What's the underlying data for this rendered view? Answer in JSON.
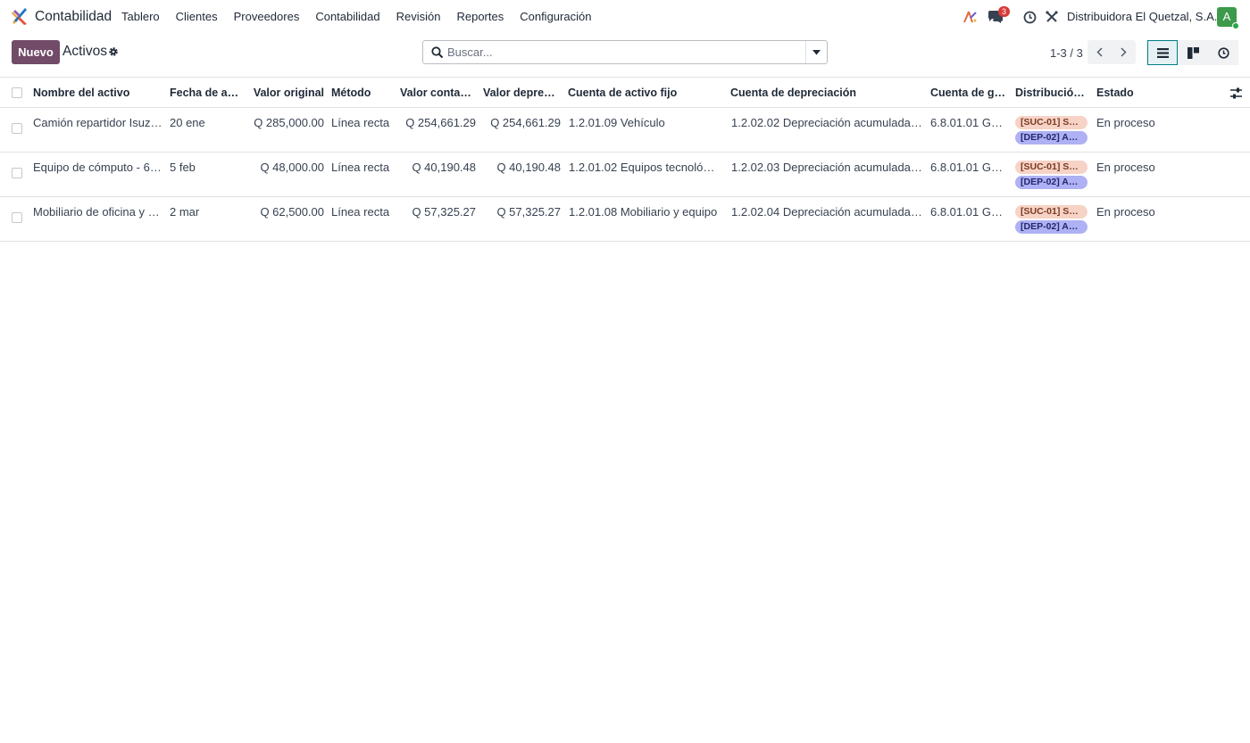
{
  "app": {
    "name": "Contabilidad",
    "menu": [
      "Tablero",
      "Clientes",
      "Proveedores",
      "Contabilidad",
      "Revisión",
      "Reportes",
      "Configuración"
    ],
    "chat_badge": "3",
    "company": "Distribuidora El Quetzal, S.A.",
    "avatar_letter": "A"
  },
  "control": {
    "new_label": "Nuevo",
    "title": "Activos",
    "search_placeholder": "Buscar...",
    "pager": "1-3 / 3"
  },
  "table": {
    "headers": {
      "name": "Nombre del activo",
      "date": "Fecha de ad…",
      "original": "Valor original",
      "method": "Método",
      "book": "Valor contable",
      "depreciable": "Valor depreci…",
      "fixed_account": "Cuenta de activo fijo",
      "dep_account": "Cuenta de depreciación",
      "exp_account": "Cuenta de ga…",
      "distribution": "Distribución …",
      "state": "Estado"
    },
    "rows": [
      {
        "name": "Camión repartidor Isuzu …",
        "date": "20 ene",
        "original": "Q 285,000.00",
        "method": "Línea recta",
        "book": "Q 254,661.29",
        "depreciable": "Q 254,661.29",
        "fixed_account": "1.2.01.09 Vehículo",
        "dep_account": "1.2.02.02 Depreciación acumulada de…",
        "exp_account": "6.8.01.01 Gas…",
        "tag1": "[SUC-01] S…",
        "tag2": "[DEP-02] A…",
        "state": "En proceso"
      },
      {
        "name": "Equipo de cómputo - 6 e…",
        "date": "5 feb",
        "original": "Q 48,000.00",
        "method": "Línea recta",
        "book": "Q 40,190.48",
        "depreciable": "Q 40,190.48",
        "fixed_account": "1.2.01.02 Equipos tecnológic…",
        "dep_account": "1.2.02.03 Depreciación acumulada de…",
        "exp_account": "6.8.01.01 Gas…",
        "tag1": "[SUC-01] S…",
        "tag2": "[DEP-02] A…",
        "state": "En proceso"
      },
      {
        "name": "Mobiliario de oficina y es…",
        "date": "2 mar",
        "original": "Q 62,500.00",
        "method": "Línea recta",
        "book": "Q 57,325.27",
        "depreciable": "Q 57,325.27",
        "fixed_account": "1.2.01.08 Mobiliario y equipo",
        "dep_account": "1.2.02.04 Depreciación acumulada de…",
        "exp_account": "6.8.01.01 Gas…",
        "tag1": "[SUC-01] S…",
        "tag2": "[DEP-02] A…",
        "state": "En proceso"
      }
    ]
  },
  "colors": {
    "brand": "#714b67",
    "active_view": "#017e84",
    "tag_suc": "#f6d3c6",
    "tag_dep": "#aeb1f3"
  }
}
